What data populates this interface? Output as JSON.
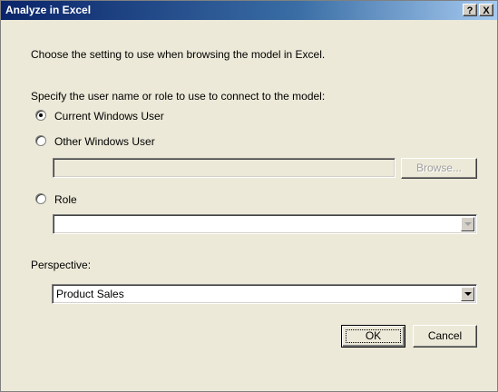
{
  "window": {
    "title": "Analyze in Excel",
    "help_label": "?",
    "close_label": "X"
  },
  "intro_text": "Choose the setting to use when browsing the model in Excel.",
  "credentials": {
    "prompt": "Specify the user name or role to use to connect to the model:",
    "options": [
      {
        "label": "Current Windows User",
        "selected": true
      },
      {
        "label": "Other Windows User",
        "selected": false
      },
      {
        "label": "Role",
        "selected": false
      }
    ],
    "other_user_value": "",
    "browse_label": "Browse...",
    "role_value": ""
  },
  "perspective": {
    "label": "Perspective:",
    "selected": "Product Sales"
  },
  "buttons": {
    "ok_label": "OK",
    "cancel_label": "Cancel"
  }
}
